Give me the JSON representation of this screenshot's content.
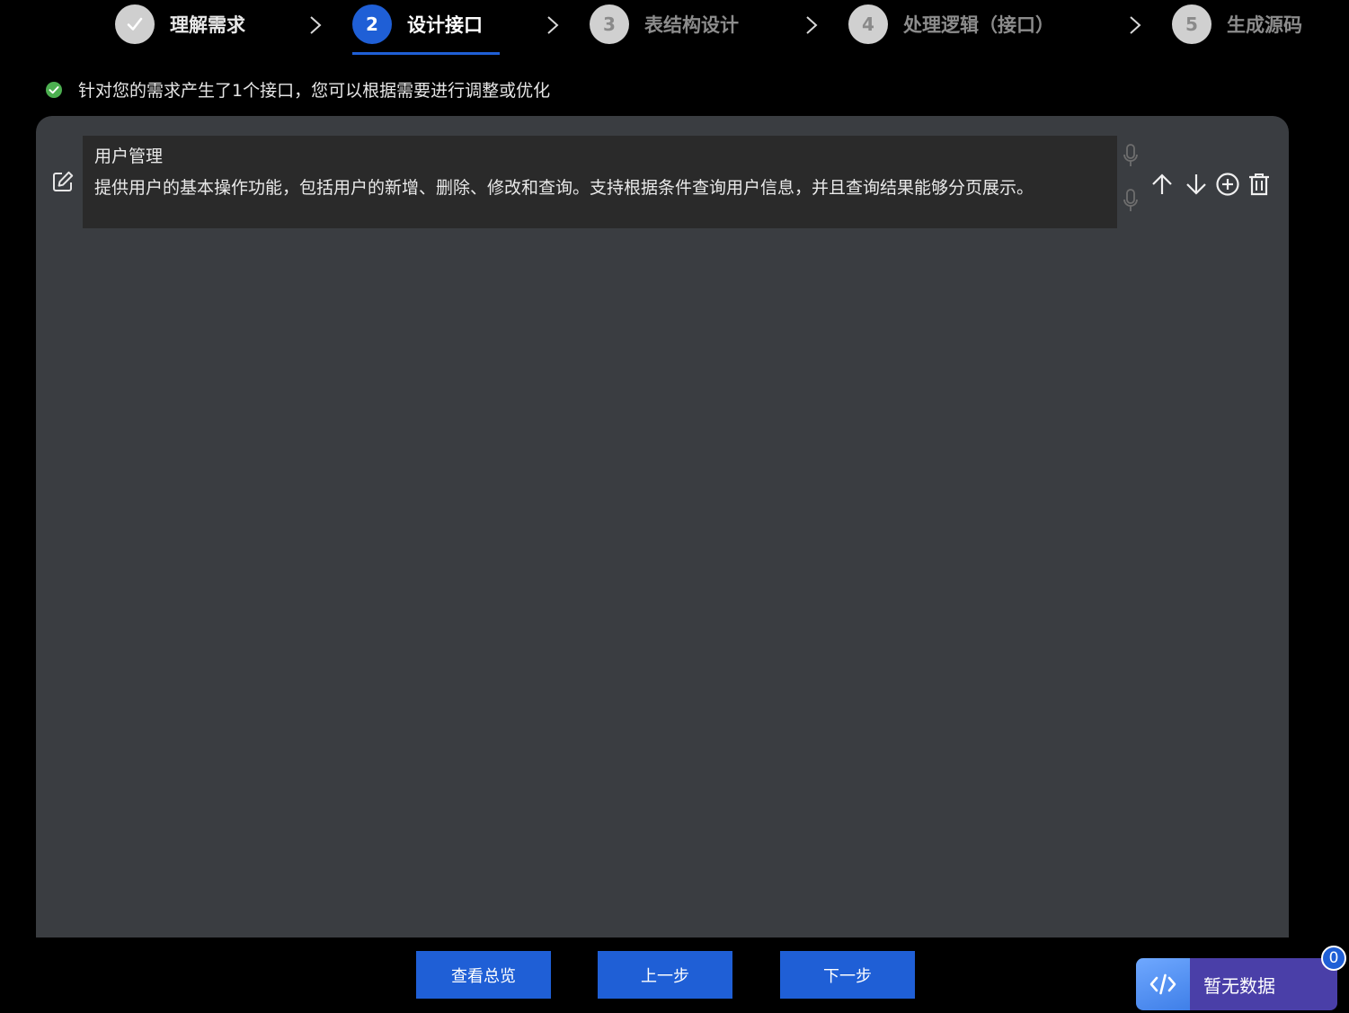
{
  "stepper": {
    "steps": [
      {
        "number": "✓",
        "label": "理解需求",
        "state": "done"
      },
      {
        "number": "2",
        "label": "设计接口",
        "state": "active"
      },
      {
        "number": "3",
        "label": "表结构设计",
        "state": "pending"
      },
      {
        "number": "4",
        "label": "处理逻辑（接口）",
        "state": "pending"
      },
      {
        "number": "5",
        "label": "生成源码",
        "state": "pending"
      }
    ]
  },
  "notice": {
    "text": "针对您的需求产生了1个接口，您可以根据需要进行调整或优化"
  },
  "interface_card": {
    "title": "用户管理",
    "description": "提供用户的基本操作功能，包括用户的新增、删除、修改和查询。支持根据条件查询用户信息，并且查询结果能够分页展示。"
  },
  "actions": {
    "buttons": [
      "查看总览",
      "上一步",
      "下一步"
    ]
  },
  "widget": {
    "status_text": "暂无数据",
    "badge_count": "0"
  },
  "colors": {
    "accent": "#1f5fd6",
    "panel": "#3a3d41",
    "card": "#2a2a2a",
    "success": "#4caf50",
    "widget": "#4a3fa8"
  },
  "icons": [
    "check-icon",
    "chevron-right-icon",
    "check-circle-icon",
    "edit-icon",
    "mic-icon",
    "arrow-up-icon",
    "arrow-down-icon",
    "plus-circle-icon",
    "trash-icon",
    "code-icon"
  ]
}
